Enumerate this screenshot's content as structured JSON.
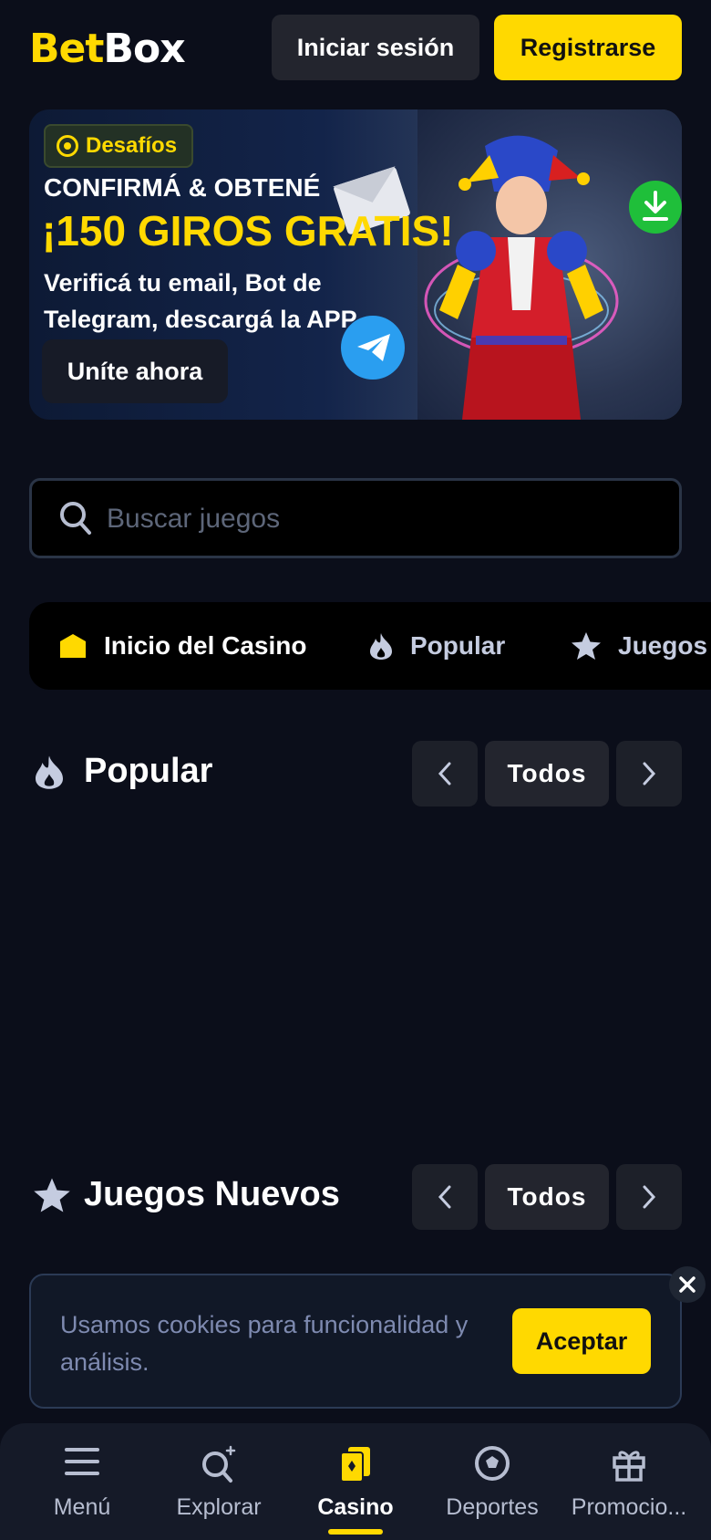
{
  "header": {
    "logo_bet": "Bet",
    "logo_box": "Box",
    "login_label": "Iniciar sesión",
    "register_label": "Registrarse"
  },
  "banner": {
    "badge": "Desafíos",
    "kicker": "CONFIRMÁ & OBTENÉ",
    "headline": "¡150 GIROS GRATIS!",
    "description": "Verificá tu email, Bot de Telegram, descargá la APP",
    "cta_label": "Uníte ahora"
  },
  "search": {
    "placeholder": "Buscar juegos"
  },
  "categories": [
    {
      "label": "Inicio del Casino",
      "icon": "home-icon"
    },
    {
      "label": "Popular",
      "icon": "fire-icon"
    },
    {
      "label": "Juegos",
      "icon": "star-icon"
    }
  ],
  "sections": {
    "popular": {
      "title": "Popular",
      "todos": "Todos",
      "icon": "fire-icon"
    },
    "nuevos": {
      "title": "Juegos Nuevos",
      "todos": "Todos",
      "icon": "star-icon"
    }
  },
  "cookie": {
    "text": "Usamos cookies para funcionalidad y análisis.",
    "accept_label": "Aceptar"
  },
  "bottom_nav": {
    "items": [
      {
        "label": "Menú",
        "icon": "hamburger-icon"
      },
      {
        "label": "Explorar",
        "icon": "explore-search-icon"
      },
      {
        "label": "Casino",
        "icon": "casino-card-icon",
        "active": true
      },
      {
        "label": "Deportes",
        "icon": "soccer-ball-icon"
      },
      {
        "label": "Promocio...",
        "icon": "gift-icon"
      }
    ]
  },
  "colors": {
    "accent": "#ffd900",
    "background": "#0b0e1a",
    "surface": "#23252e"
  }
}
